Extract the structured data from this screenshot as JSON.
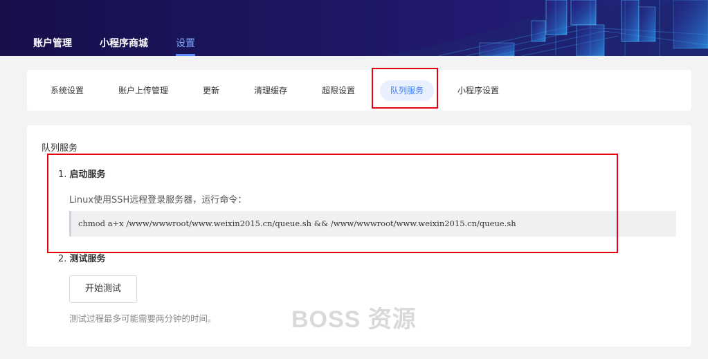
{
  "header": {
    "nav": [
      {
        "label": "账户管理"
      },
      {
        "label": "小程序商城"
      },
      {
        "label": "设置",
        "active": true
      }
    ]
  },
  "tabs": [
    {
      "label": "系统设置"
    },
    {
      "label": "账户上传管理"
    },
    {
      "label": "更新"
    },
    {
      "label": "清理缓存"
    },
    {
      "label": "超限设置"
    },
    {
      "label": "队列服务",
      "active": true
    },
    {
      "label": "小程序设置"
    }
  ],
  "main": {
    "section_title": "队列服务",
    "step1": {
      "number": "1.",
      "title": "启动服务"
    },
    "step1_desc": "Linux使用SSH远程登录服务器，运行命令：",
    "command": "chmod a+x /www/wwwroot/www.weixin2015.cn/queue.sh && /www/wwwroot/www.weixin2015.cn/queue.sh",
    "step2": {
      "number": "2.",
      "title": "测试服务"
    },
    "test_button": "开始测试",
    "test_note": "测试过程最多可能需要两分钟的时间。"
  },
  "watermark": "BOSS 资源",
  "colors": {
    "accent": "#3a7bff",
    "highlight": "#e60012",
    "header_bg": "#1c1660"
  }
}
